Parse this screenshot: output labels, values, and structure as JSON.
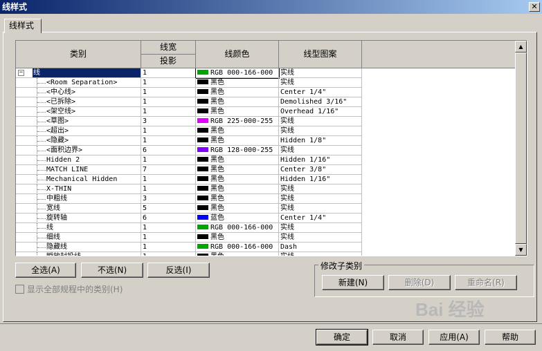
{
  "window": {
    "title": "线样式",
    "close_glyph": "✕"
  },
  "tab": {
    "label": "线样式"
  },
  "grid": {
    "headers": {
      "category": "类别",
      "line_weight": "线宽",
      "projection": "投影",
      "line_color": "线颜色",
      "line_pattern": "线型图案"
    },
    "root": {
      "expander": "−",
      "label": "线",
      "weight": "1",
      "color_hex": "#00a600",
      "color_label": "RGB 000-166-000",
      "pattern": "实线"
    },
    "rows": [
      {
        "name": "<Room Separation>",
        "weight": "1",
        "color_hex": "#000000",
        "color_label": "黑色",
        "pattern": "实线"
      },
      {
        "name": "<中心线>",
        "weight": "1",
        "color_hex": "#000000",
        "color_label": "黑色",
        "pattern": "Center 1/4\""
      },
      {
        "name": "<已拆除>",
        "weight": "1",
        "color_hex": "#000000",
        "color_label": "黑色",
        "pattern": "Demolished 3/16\""
      },
      {
        "name": "<架空线>",
        "weight": "1",
        "color_hex": "#000000",
        "color_label": "黑色",
        "pattern": "Overhead 1/16\""
      },
      {
        "name": "<草图>",
        "weight": "3",
        "color_hex": "#e100ff",
        "color_label": "RGB 225-000-255",
        "pattern": "实线"
      },
      {
        "name": "<超出>",
        "weight": "1",
        "color_hex": "#000000",
        "color_label": "黑色",
        "pattern": "实线"
      },
      {
        "name": "<隐藏>",
        "weight": "1",
        "color_hex": "#000000",
        "color_label": "黑色",
        "pattern": "Hidden 1/8\""
      },
      {
        "name": "<面积边界>",
        "weight": "6",
        "color_hex": "#8000ff",
        "color_label": "RGB 128-000-255",
        "pattern": "实线"
      },
      {
        "name": "Hidden 2",
        "weight": "1",
        "color_hex": "#000000",
        "color_label": "黑色",
        "pattern": "Hidden 1/16\""
      },
      {
        "name": "MATCH LINE",
        "weight": "7",
        "color_hex": "#000000",
        "color_label": "黑色",
        "pattern": "Center 3/8\""
      },
      {
        "name": "Mechanical Hidden",
        "weight": "1",
        "color_hex": "#000000",
        "color_label": "黑色",
        "pattern": "Hidden 1/16\""
      },
      {
        "name": "X-THIN",
        "weight": "1",
        "color_hex": "#000000",
        "color_label": "黑色",
        "pattern": "实线"
      },
      {
        "name": "中粗线",
        "weight": "3",
        "color_hex": "#000000",
        "color_label": "黑色",
        "pattern": "实线"
      },
      {
        "name": "宽线",
        "weight": "5",
        "color_hex": "#000000",
        "color_label": "黑色",
        "pattern": "实线"
      },
      {
        "name": "旋转轴",
        "weight": "6",
        "color_hex": "#0000ff",
        "color_label": "蓝色",
        "pattern": "Center 1/4\""
      },
      {
        "name": "线",
        "weight": "1",
        "color_hex": "#00a600",
        "color_label": "RGB 000-166-000",
        "pattern": "实线"
      },
      {
        "name": "细线",
        "weight": "1",
        "color_hex": "#000000",
        "color_label": "黑色",
        "pattern": "实线"
      },
      {
        "name": "隐藏线",
        "weight": "1",
        "color_hex": "#00a600",
        "color_label": "RGB 000-166-000",
        "pattern": "Dash"
      },
      {
        "name": "瞬放封投线",
        "weight": "1",
        "color_hex": "#000000",
        "color_label": "黑色",
        "pattern": "实线"
      }
    ]
  },
  "scroll": {
    "up": "▲",
    "down": "▼"
  },
  "buttons": {
    "select_all": "全选(A)",
    "select_none": "不选(N)",
    "invert": "反选(I)"
  },
  "checkbox": {
    "label": "显示全部规程中的类别(H)"
  },
  "modify_group": {
    "legend": "修改子类别",
    "new": "新建(N)",
    "delete": "删除(D)",
    "rename": "重命名(R)"
  },
  "footer": {
    "ok": "确定",
    "cancel": "取消",
    "apply": "应用(A)",
    "help": "帮助"
  },
  "watermark": "Bai 经验"
}
